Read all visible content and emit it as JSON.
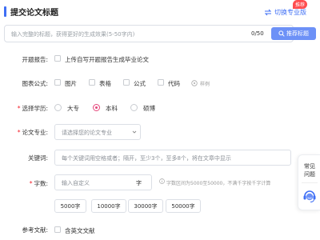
{
  "header": {
    "title": "提交论文标题",
    "switch_label": "切换专业版",
    "badge": "推荐"
  },
  "title_input": {
    "placeholder": "输入完整的标题，获得更好的生成效果(5-50字内)",
    "count": "0/50",
    "recommend_label": "推荐标题"
  },
  "proposal": {
    "label": "开题报告:",
    "option": "上传自写开题报告生成毕业论文"
  },
  "charts": {
    "label": "图表公式:",
    "options": [
      "图片",
      "表格",
      "公式",
      "代码"
    ],
    "example": "样例"
  },
  "degree": {
    "label": "选择学历:",
    "options": [
      "大专",
      "本科",
      "硕博"
    ],
    "selected": "本科"
  },
  "major": {
    "label": "论文专业:",
    "placeholder": "请选择您的论文专业"
  },
  "keywords": {
    "label": "关键词:",
    "placeholder": "每个关键词用空格或者；隔开，至少3个，至多8个，将在文章中显示"
  },
  "word_count": {
    "label": "字数:",
    "placeholder": "输入自定义",
    "unit": "字",
    "hint": "字数区间为5000至50000，不满千字按千字计算",
    "presets": [
      "5000字",
      "10000字",
      "30000字",
      "50000字"
    ]
  },
  "reference": {
    "label": "参考文献:",
    "option": "含英文文献"
  },
  "side": {
    "faq": "常见问题"
  },
  "colors": {
    "accent": "#3f6ff5",
    "button": "#6d91f7",
    "radio_selected": "#e5467a",
    "badge": "#ff4d4f"
  }
}
